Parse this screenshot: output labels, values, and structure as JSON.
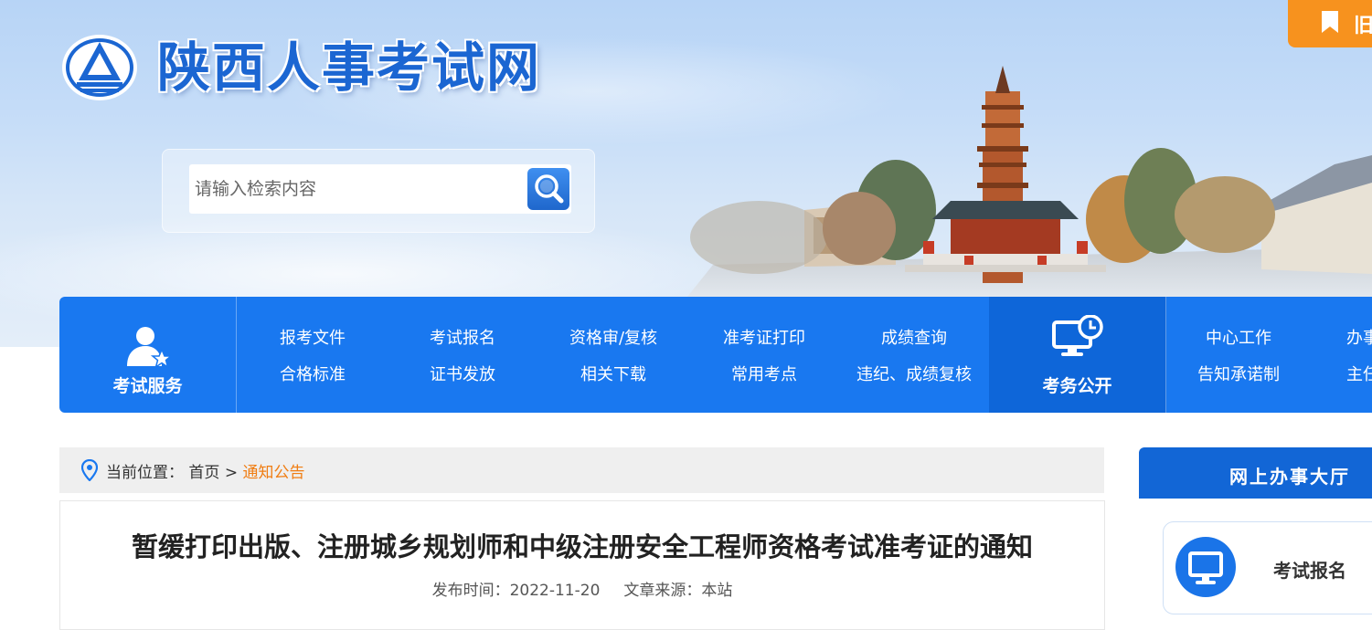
{
  "header": {
    "site_title": "陕西人事考试网",
    "old_version_label": "旧",
    "search": {
      "placeholder": "请输入检索内容"
    }
  },
  "nav": {
    "service_block": {
      "label": "考试服务",
      "icon": "person-star-icon"
    },
    "service_links": [
      [
        "报考文件",
        "合格标准"
      ],
      [
        "考试报名",
        "证书发放"
      ],
      [
        "资格审/复核",
        "相关下载"
      ],
      [
        "准考证打印",
        "常用考点"
      ],
      [
        "成绩查询",
        "违纪、成绩复核"
      ]
    ],
    "public_block": {
      "label": "考务公开",
      "icon": "monitor-clock-icon"
    },
    "public_links": [
      [
        "中心工作",
        "告知承诺制"
      ],
      [
        "办事",
        "主任"
      ]
    ]
  },
  "breadcrumb": {
    "prefix": "当前位置：",
    "home": "首页",
    "separator": ">",
    "current": "通知公告"
  },
  "article": {
    "title": "暂缓打印出版、注册城乡规划师和中级注册安全工程师资格考试准考证的通知",
    "publish_label": "发布时间：",
    "publish_date": "2022-11-20",
    "source_label": "文章来源：",
    "source": "本站"
  },
  "sidebar": {
    "title": "网上办事大厅",
    "items": [
      {
        "label": "考试报名",
        "icon": "monitor-icon"
      }
    ]
  },
  "colors": {
    "nav_blue": "#1978f0",
    "nav_dark_blue": "#0e66d9",
    "accent_orange": "#f7921e",
    "breadcrumb_current": "#f07d12",
    "title_blue": "#1b66d2"
  }
}
